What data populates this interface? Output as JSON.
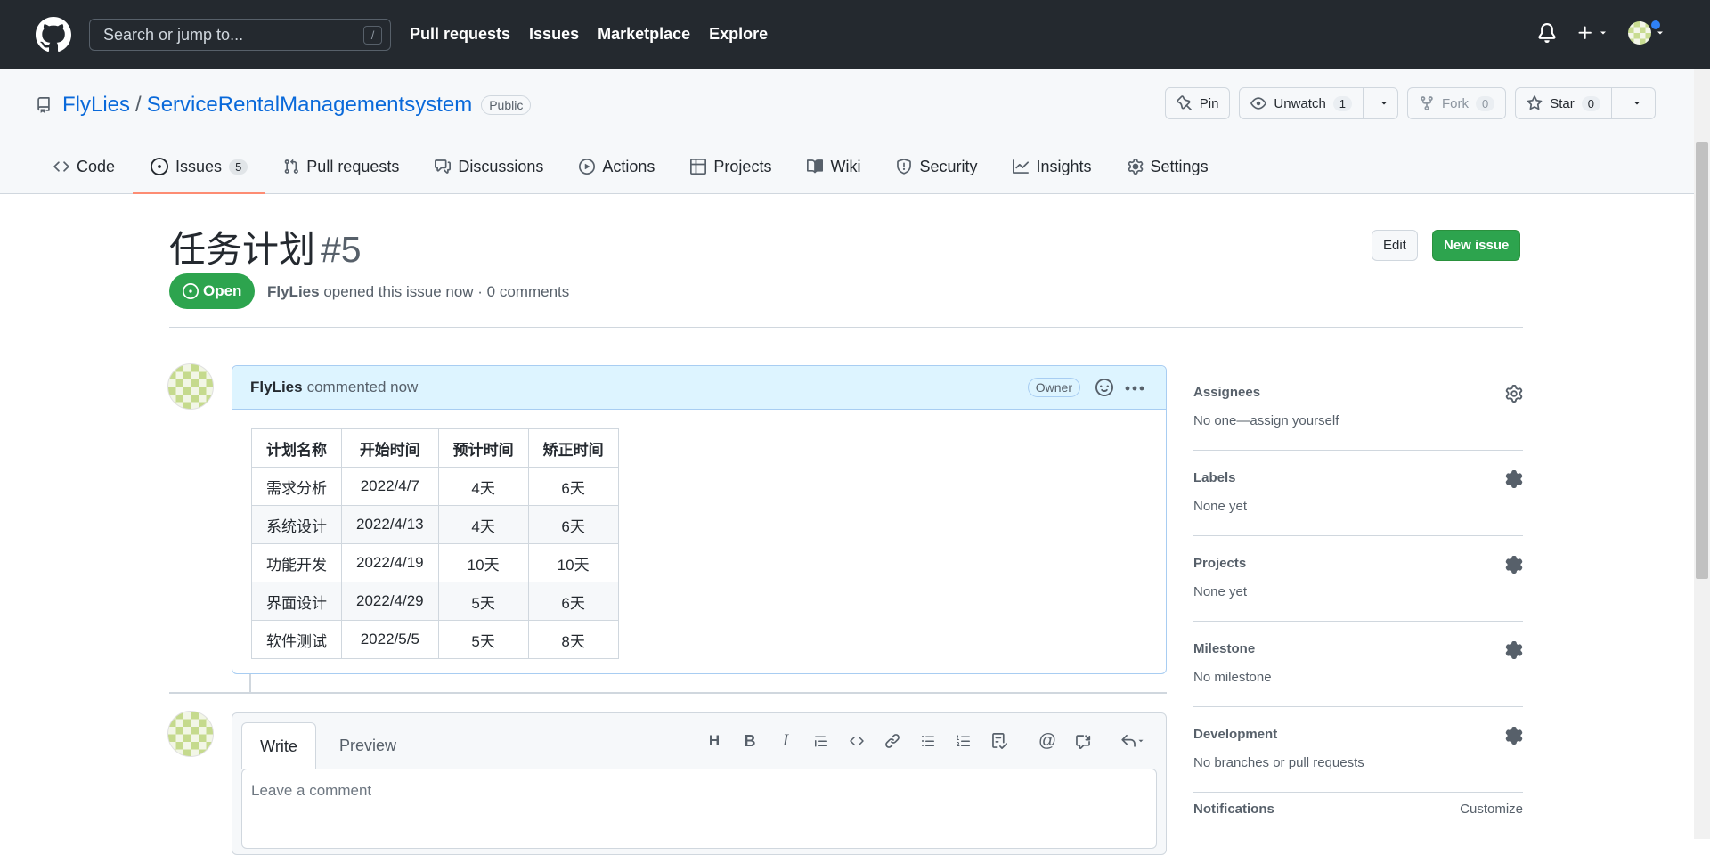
{
  "header": {
    "search_placeholder": "Search or jump to...",
    "search_shortcut": "/",
    "nav": [
      "Pull requests",
      "Issues",
      "Marketplace",
      "Explore"
    ]
  },
  "repo": {
    "owner": "FlyLies",
    "separator": "/",
    "name": "ServiceRentalManagementsystem",
    "visibility": "Public",
    "pin_label": "Pin",
    "watch_label": "Unwatch",
    "watch_count": "1",
    "fork_label": "Fork",
    "fork_count": "0",
    "star_label": "Star",
    "star_count": "0"
  },
  "tabs": [
    {
      "label": "Code",
      "icon": "code-icon"
    },
    {
      "label": "Issues",
      "icon": "issue-opened-icon",
      "count": "5"
    },
    {
      "label": "Pull requests",
      "icon": "git-pull-request-icon"
    },
    {
      "label": "Discussions",
      "icon": "comment-discussion-icon"
    },
    {
      "label": "Actions",
      "icon": "play-icon"
    },
    {
      "label": "Projects",
      "icon": "table-icon"
    },
    {
      "label": "Wiki",
      "icon": "book-icon"
    },
    {
      "label": "Security",
      "icon": "shield-icon"
    },
    {
      "label": "Insights",
      "icon": "graph-icon"
    },
    {
      "label": "Settings",
      "icon": "gear-icon"
    }
  ],
  "issue": {
    "title": "任务计划",
    "number": "#5",
    "state": "Open",
    "author": "FlyLies",
    "meta": "opened this issue now · 0 comments",
    "edit_label": "Edit",
    "new_issue_label": "New issue"
  },
  "comment": {
    "author": "FlyLies",
    "action": "commented now",
    "role_badge": "Owner",
    "table": {
      "headers": [
        "计划名称",
        "开始时间",
        "预计时间",
        "矫正时间"
      ],
      "rows": [
        [
          "需求分析",
          "2022/4/7",
          "4天",
          "6天"
        ],
        [
          "系统设计",
          "2022/4/13",
          "4天",
          "6天"
        ],
        [
          "功能开发",
          "2022/4/19",
          "10天",
          "10天"
        ],
        [
          "界面设计",
          "2022/4/29",
          "5天",
          "6天"
        ],
        [
          "软件测试",
          "2022/5/5",
          "5天",
          "8天"
        ]
      ]
    }
  },
  "new_comment": {
    "write_tab": "Write",
    "preview_tab": "Preview",
    "placeholder": "Leave a comment"
  },
  "sidebar": {
    "assignees": {
      "label": "Assignees",
      "value": "No one—assign yourself"
    },
    "labels": {
      "label": "Labels",
      "value": "None yet"
    },
    "projects": {
      "label": "Projects",
      "value": "None yet"
    },
    "milestone": {
      "label": "Milestone",
      "value": "No milestone"
    },
    "development": {
      "label": "Development",
      "value": "No branches or pull requests"
    },
    "notifications": {
      "label": "Notifications",
      "customize": "Customize"
    }
  },
  "colors": {
    "header_bg": "#24292f",
    "open_green": "#2da44e",
    "link_blue": "#0969da",
    "comment_head_bg": "#ddf4ff",
    "active_tab_underline": "#fd8c73"
  }
}
